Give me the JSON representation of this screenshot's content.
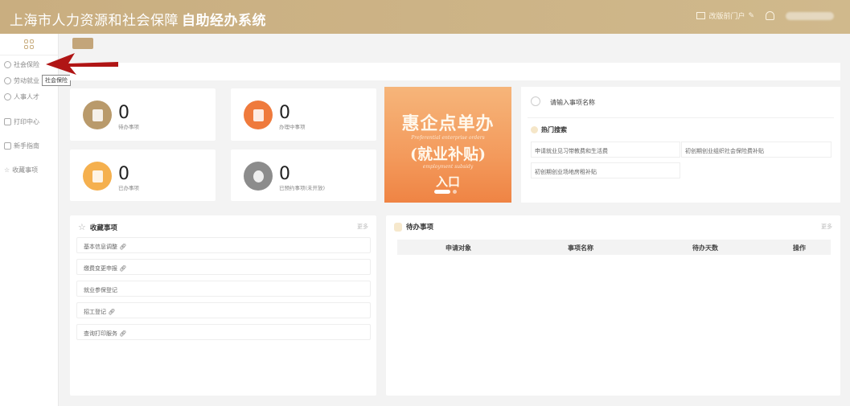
{
  "header": {
    "title": "上海市人力资源和社会保障",
    "title_bold": "自助经办系统",
    "portal_link": "改版前门户",
    "icons": [
      "monitor-icon",
      "bell-icon",
      "user-avatar"
    ]
  },
  "sidebar": {
    "items": [
      {
        "label": "社会保险",
        "icon": "globe-icon"
      },
      {
        "label": "劳动就业",
        "icon": "person-icon"
      },
      {
        "label": "人事人才",
        "icon": "people-icon"
      },
      {
        "label": "打印中心",
        "icon": "printer-icon"
      },
      {
        "label": "新手指南",
        "icon": "guide-icon"
      },
      {
        "label": "收藏事项",
        "icon": "star-icon"
      }
    ],
    "tooltip": "社会保险"
  },
  "stats": [
    {
      "value": "0",
      "label": "待办事项",
      "color": "#b99a6b"
    },
    {
      "value": "0",
      "label": "办理中事项",
      "color": "#ef7a3c"
    },
    {
      "value": "0",
      "label": "已办事项",
      "color": "#f5b04e"
    },
    {
      "value": "0",
      "label": "已预约事项(未开放)",
      "color": "#8c8c8c"
    }
  ],
  "banner": {
    "line1": "惠企点单办",
    "en1": "Preferential enterprise orders",
    "line2": "(就业补贴)",
    "en2": "employment subsidy",
    "line3": "入口"
  },
  "search": {
    "placeholder": "请输入事项名称",
    "hot_title": "热门搜索",
    "hot_items": [
      "申请就业见习带教费和生活费",
      "初创期创业组织社会保险费补贴",
      "初创期创业场地房租补贴"
    ]
  },
  "favorites": {
    "title": "收藏事项",
    "more": "更多",
    "items": [
      "基本信息调整",
      "缴费变更申报",
      "就业参保登记",
      "招工登记",
      "查询打印服务"
    ]
  },
  "pending": {
    "title": "待办事项",
    "more": "更多",
    "columns": [
      "申请对象",
      "事项名称",
      "待办天数",
      "操作"
    ],
    "rows": []
  }
}
